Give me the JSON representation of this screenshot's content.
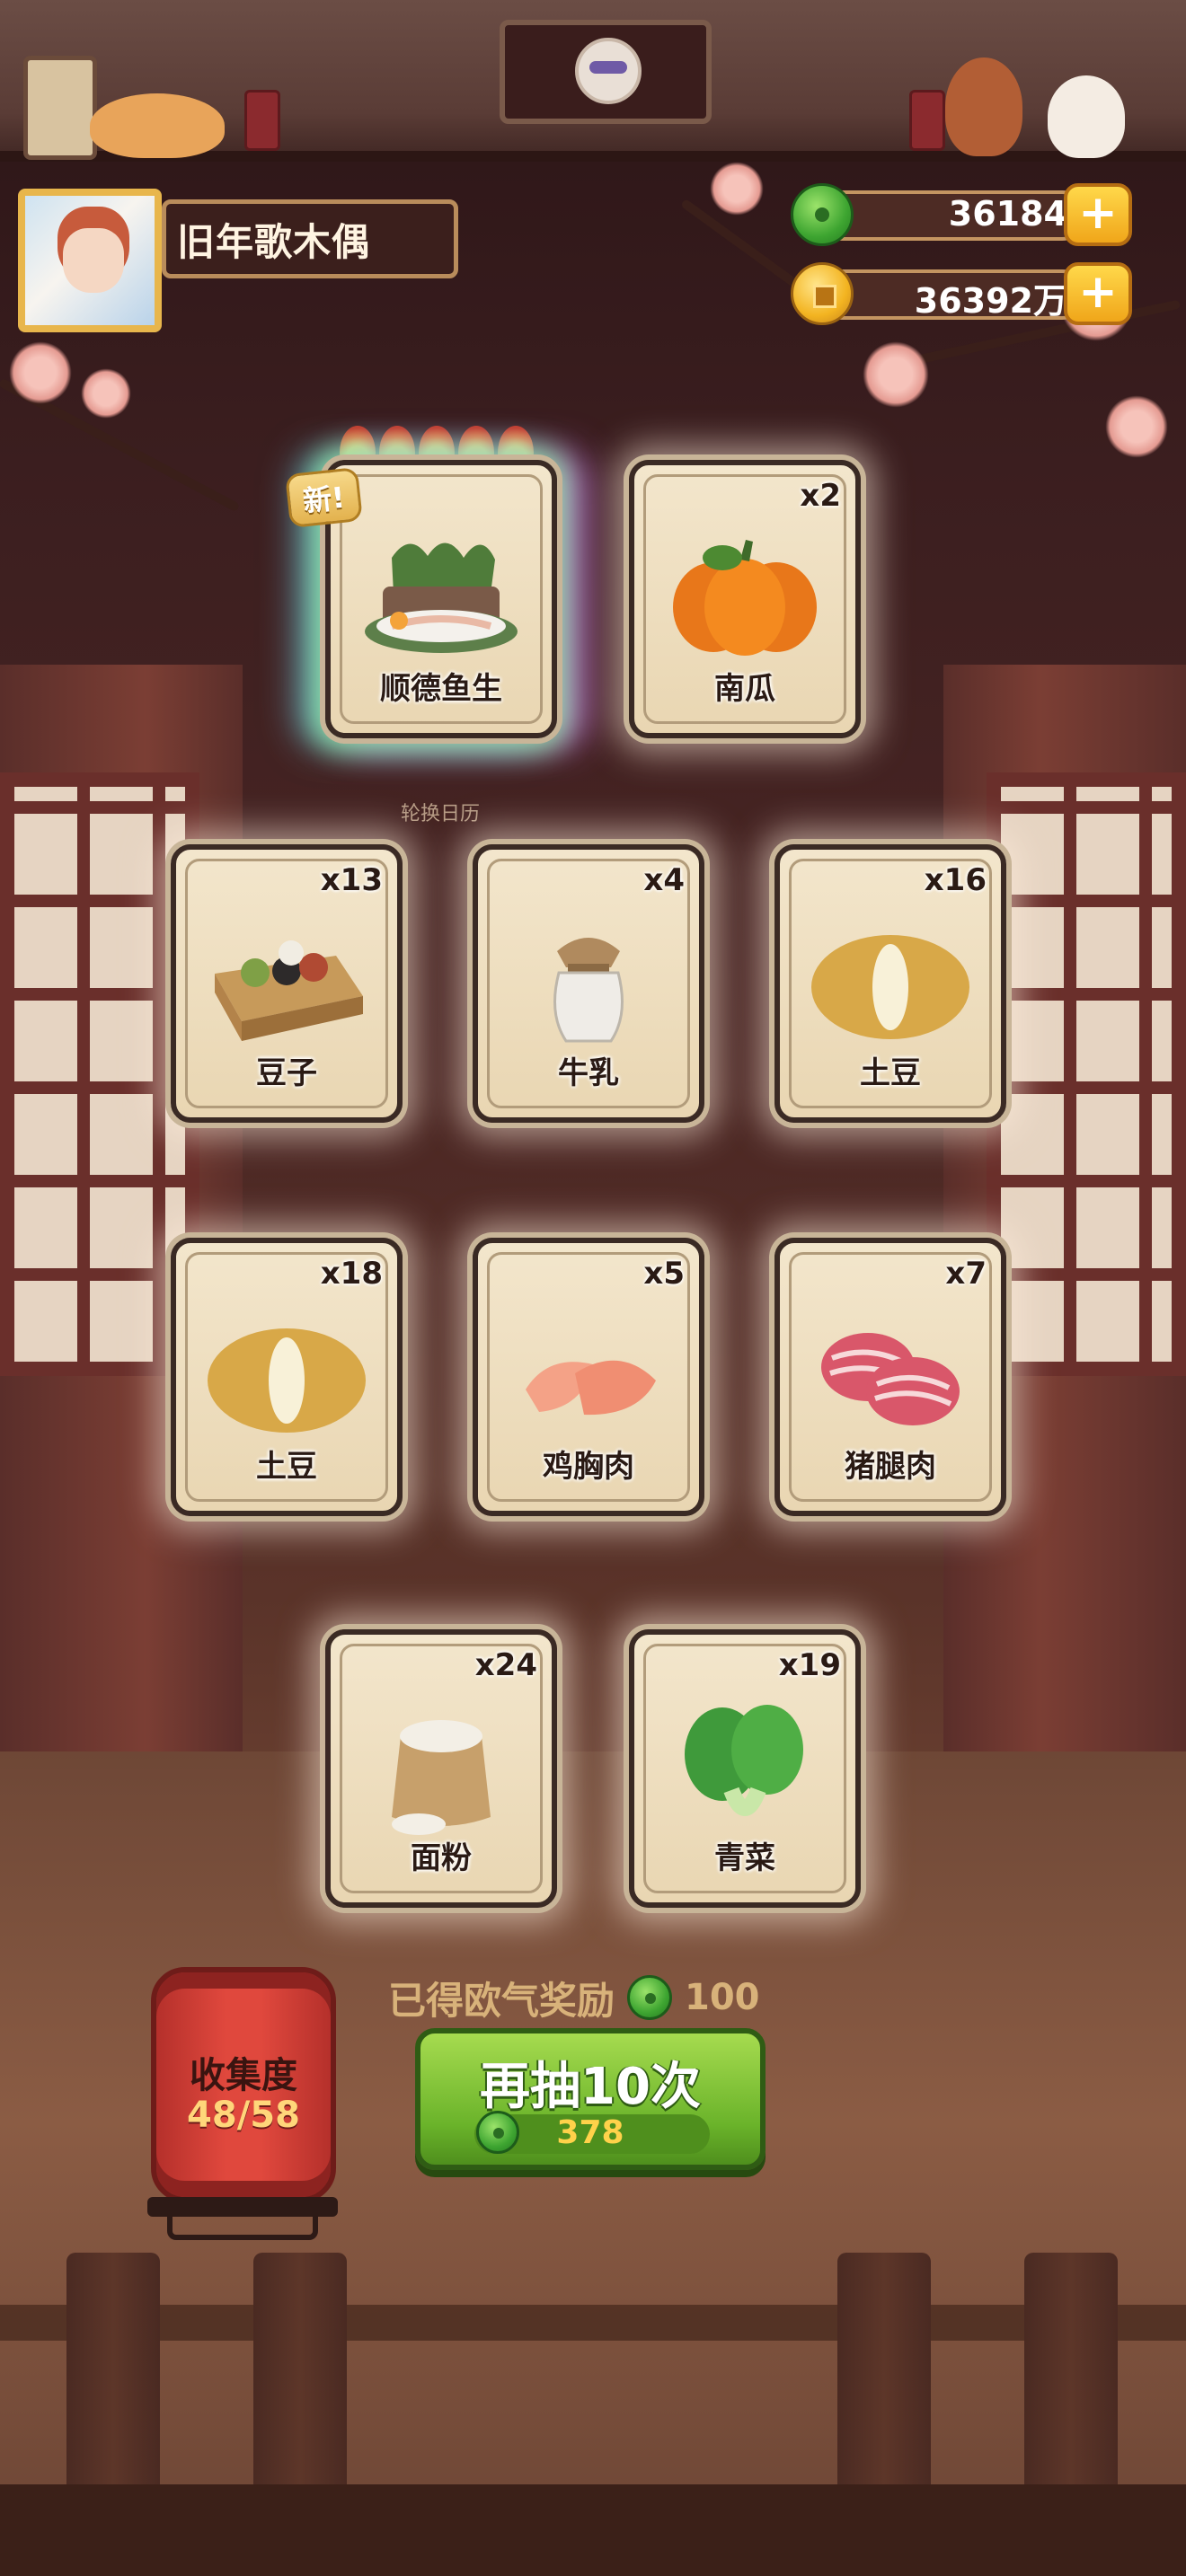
{
  "player": {
    "name": "旧年歌木偶"
  },
  "currency": {
    "jade": "36184",
    "gold": "36392万",
    "add_symbol": "+"
  },
  "featured_card": {
    "badge": "新!",
    "rarity_flames": 5,
    "name": "顺德鱼生",
    "caption": "轮换日历"
  },
  "cards": [
    {
      "name": "南瓜",
      "count": "x2",
      "icon": "pumpkin-icon"
    },
    {
      "name": "豆子",
      "count": "x13",
      "icon": "beans-icon"
    },
    {
      "name": "牛乳",
      "count": "x4",
      "icon": "milk-jar-icon"
    },
    {
      "name": "土豆",
      "count": "x16",
      "icon": "potato-icon"
    },
    {
      "name": "土豆",
      "count": "x18",
      "icon": "potato-icon"
    },
    {
      "name": "鸡胸肉",
      "count": "x5",
      "icon": "chicken-breast-icon"
    },
    {
      "name": "猪腿肉",
      "count": "x7",
      "icon": "pork-leg-icon"
    },
    {
      "name": "面粉",
      "count": "x24",
      "icon": "flour-sack-icon"
    },
    {
      "name": "青菜",
      "count": "x19",
      "icon": "bok-choy-icon"
    }
  ],
  "collection": {
    "title": "收集度",
    "progress": "48/58"
  },
  "luck_reward": {
    "label": "已得欧气奖励",
    "value": "100"
  },
  "draw_button": {
    "label": "再抽10次",
    "cost": "378"
  },
  "colors": {
    "jade": "#3ea531",
    "gold": "#f3b421",
    "button_green": "#6ab32a",
    "lantern_red": "#e0483d"
  }
}
